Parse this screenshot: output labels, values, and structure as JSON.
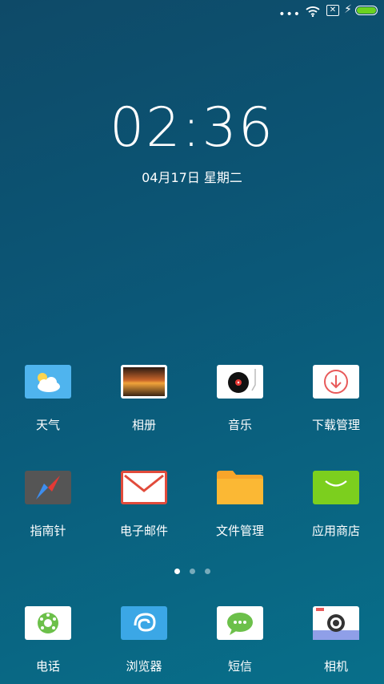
{
  "status": {
    "more": "•••"
  },
  "lockscreen": {
    "time": "02:36",
    "date": "04月17日 星期二"
  },
  "apps_row1": [
    {
      "label": "天气"
    },
    {
      "label": "相册"
    },
    {
      "label": "音乐"
    },
    {
      "label": "下载管理"
    }
  ],
  "apps_row2": [
    {
      "label": "指南针"
    },
    {
      "label": "电子邮件"
    },
    {
      "label": "文件管理"
    },
    {
      "label": "应用商店"
    }
  ],
  "dock": [
    {
      "label": "电话"
    },
    {
      "label": "浏览器"
    },
    {
      "label": "短信"
    },
    {
      "label": "相机"
    }
  ],
  "pager": {
    "pages": 3,
    "current": 1
  },
  "battery": {
    "level_pct": 100,
    "color": "#6bd21f"
  }
}
